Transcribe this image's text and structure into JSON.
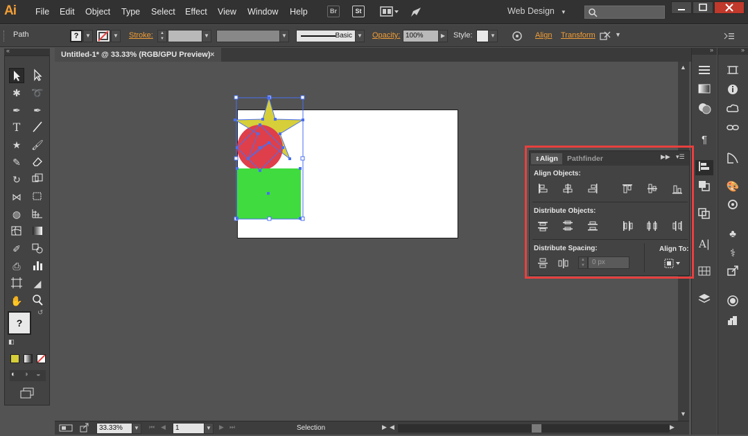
{
  "app": {
    "logo": "Ai"
  },
  "menu": [
    "File",
    "Edit",
    "Object",
    "Type",
    "Select",
    "Effect",
    "View",
    "Window",
    "Help"
  ],
  "menubar": {
    "bridge": "Br",
    "stock": "St",
    "workspace": "Web Design"
  },
  "control_bar": {
    "selection_type": "Path",
    "fill_value": "?",
    "stroke_label": "Stroke:",
    "brush_label": "Basic",
    "opacity_label": "Opacity:",
    "opacity_value": "100%",
    "style_label": "Style:",
    "align_label": "Align",
    "transform_label": "Transform"
  },
  "document": {
    "tab_title": "Untitled-1* @ 33.33% (RGB/GPU Preview)"
  },
  "status_bar": {
    "zoom": "33.33%",
    "artboard_number": "1",
    "tool_name": "Selection"
  },
  "colors": {
    "accent": "#f29e35",
    "highlight": "#e8403f",
    "star": "#d6cf3a",
    "circle": "#de3f4a",
    "rect": "#3fdb3f",
    "selection": "#4a6ff0"
  },
  "align_panel": {
    "tabs": [
      "Align",
      "Pathfinder"
    ],
    "align_objects_label": "Align Objects:",
    "distribute_objects_label": "Distribute Objects:",
    "distribute_spacing_label": "Distribute Spacing:",
    "align_to_label": "Align To:",
    "spacing_value": "0 px"
  },
  "toolbox": {
    "fill_stroke_value": "?"
  }
}
